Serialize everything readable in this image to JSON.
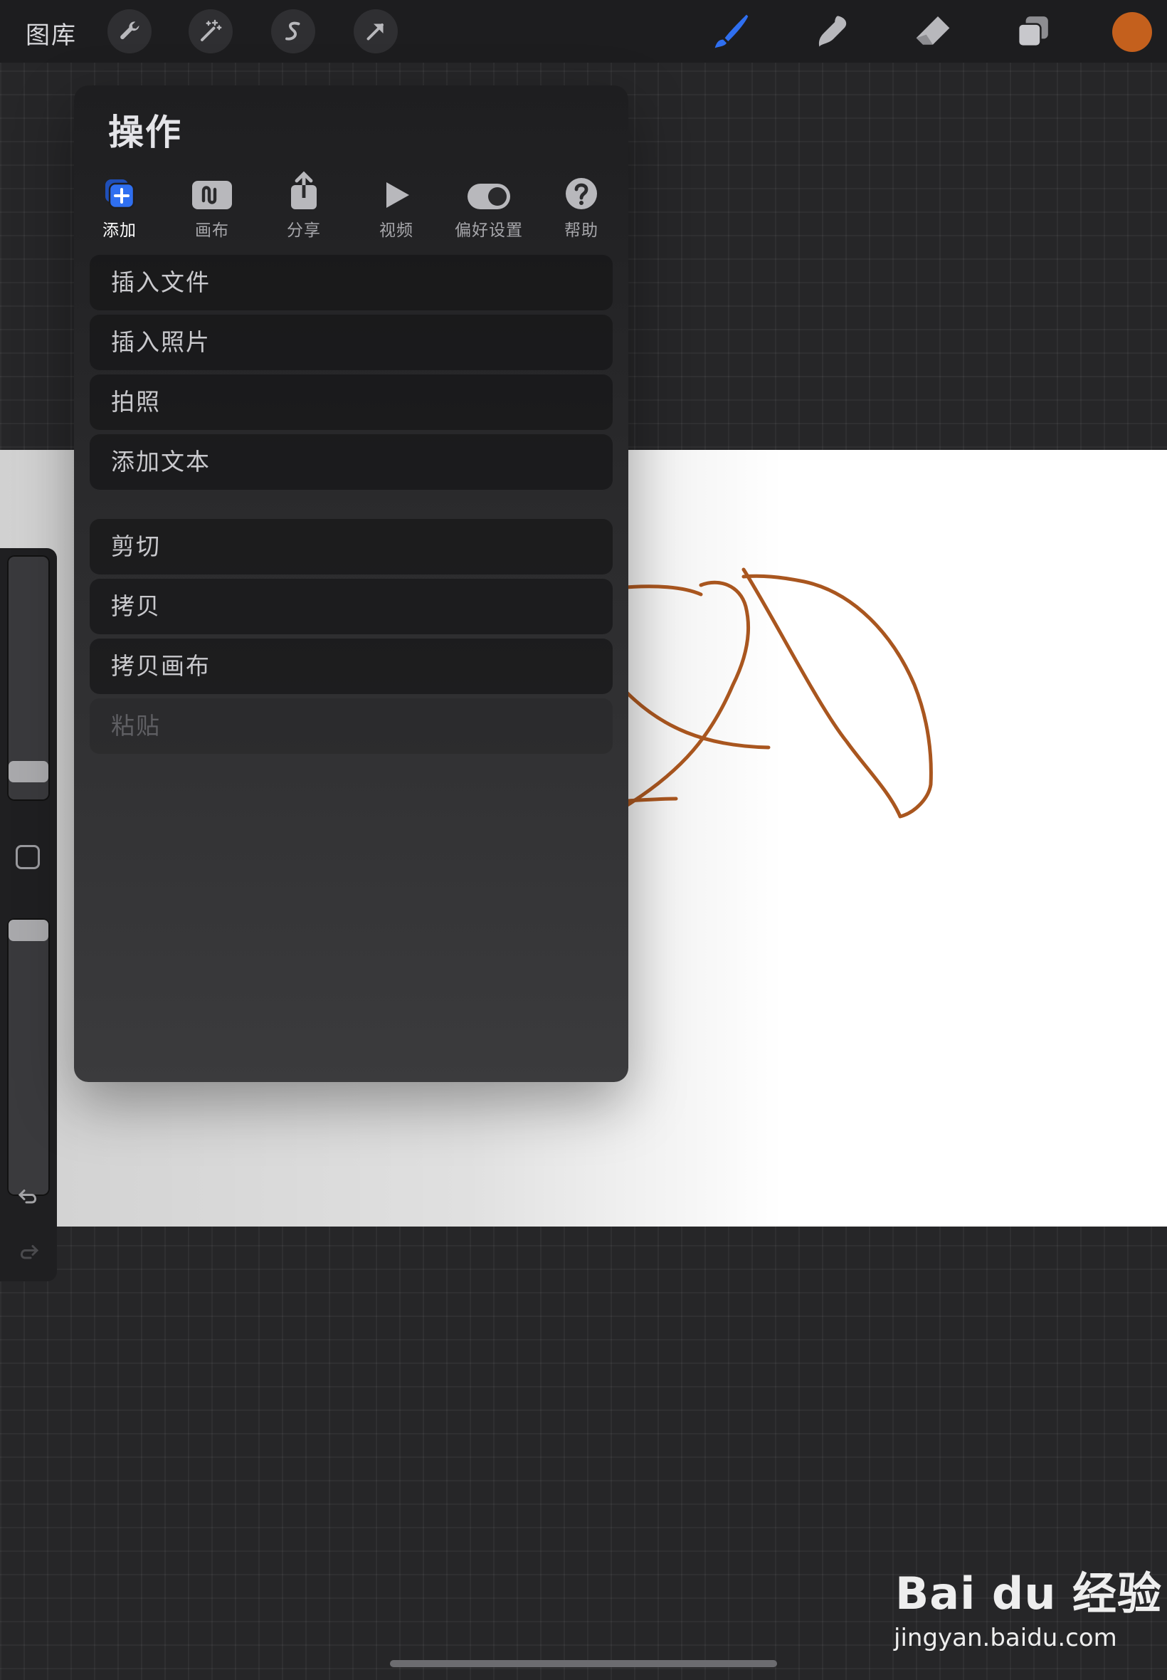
{
  "toolbar": {
    "gallery_label": "图库",
    "left_tools": [
      "wrench-icon",
      "magic-wand-icon",
      "selection-s-icon",
      "transform-arrow-icon"
    ],
    "right_tools": [
      "brush-icon",
      "smudge-icon",
      "eraser-icon",
      "layers-icon"
    ],
    "active_tool": "brush-icon",
    "current_color": "#c4601d",
    "accent": "#2f6ff0"
  },
  "actions_panel": {
    "title": "操作",
    "tabs": [
      {
        "label": "添加",
        "icon": "add-icon"
      },
      {
        "label": "画布",
        "icon": "canvas-icon"
      },
      {
        "label": "分享",
        "icon": "share-icon"
      },
      {
        "label": "视频",
        "icon": "video-play-icon"
      },
      {
        "label": "偏好设置",
        "icon": "toggle-icon"
      },
      {
        "label": "帮助",
        "icon": "help-icon"
      }
    ],
    "active_tab": "添加",
    "group1": [
      "插入文件",
      "插入照片",
      "拍照",
      "添加文本"
    ],
    "group2": [
      "剪切",
      "拷贝",
      "拷贝画布",
      "粘贴"
    ],
    "disabled_items": [
      "粘贴"
    ]
  },
  "sidebar": {
    "brush_size_level": 0.18,
    "opacity_level": 1.0
  },
  "watermark": {
    "logo": "Bai du 经验",
    "url": "jingyan.baidu.com"
  }
}
